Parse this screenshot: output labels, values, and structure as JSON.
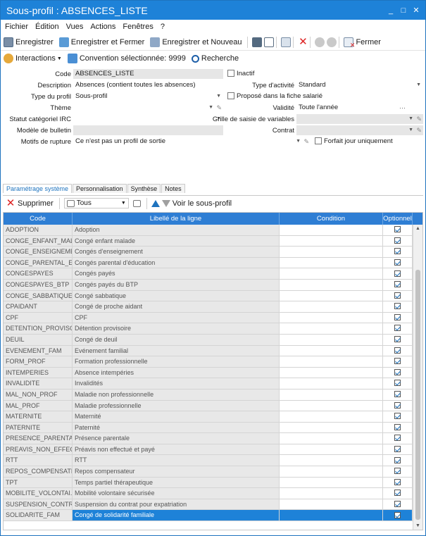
{
  "window": {
    "title": "Sous-profil : ABSENCES_LISTE",
    "controls": [
      "_",
      "□",
      "✕"
    ]
  },
  "menu": [
    "Fichier",
    "Édition",
    "Vues",
    "Actions",
    "Fenêtres",
    "?"
  ],
  "toolbar": {
    "save": "Enregistrer",
    "save_close": "Enregistrer et Fermer",
    "save_new": "Enregistrer et Nouveau",
    "close": "Fermer"
  },
  "toolbar2": {
    "interactions": "Interactions",
    "convention": "Convention sélectionnée: 9999",
    "search": "Recherche"
  },
  "form": {
    "code_label": "Code",
    "code_value": "ABSENCES_LISTE",
    "desc_label": "Description",
    "desc_value": "Absences (contient toutes les absences)",
    "type_label": "Type du profil",
    "type_value": "Sous-profil",
    "theme_label": "Thème",
    "statut_label": "Statut catégoriel IRC",
    "modele_label": "Modèle de bulletin",
    "motifs_label": "Motifs de rupture",
    "motifs_value": "Ce n'est pas un profil de sortie",
    "inactif_label": "Inactif",
    "type_activite_label": "Type d'activité",
    "type_activite_value": "Standard",
    "propose_label": "Proposé dans la fiche salarié",
    "validite_label": "Validité",
    "validite_value": "Toute l'année",
    "grille_label": "Grille de saisie de variables",
    "contrat_label": "Contrat",
    "forfait_label": "Forfait jour uniquement"
  },
  "tabs": [
    "Paramétrage système",
    "Personnalisation",
    "Synthèse",
    "Notes"
  ],
  "gridbar": {
    "delete": "Supprimer",
    "filter": "Tous",
    "view": "Voir le sous-profil"
  },
  "grid": {
    "headers": [
      "Code",
      "Libellé de la ligne",
      "Condition",
      "Optionnel"
    ],
    "rows": [
      [
        "ADOPTION",
        "Adoption"
      ],
      [
        "CONGE_ENFANT_MAL...",
        "Congé enfant malade"
      ],
      [
        "CONGE_ENSEIGNEMENT",
        "Congés d'enseignement"
      ],
      [
        "CONGE_PARENTAL_E...",
        "Congés parental d'éducation"
      ],
      [
        "CONGESPAYES",
        "Congés payés"
      ],
      [
        "CONGESPAYES_BTP",
        "Congés payés du BTP"
      ],
      [
        "CONGE_SABBATIQUE",
        "Congé sabbatique"
      ],
      [
        "CPAIDANT",
        "Congé de proche aidant"
      ],
      [
        "CPF",
        "CPF"
      ],
      [
        "DETENTION_PROVISO...",
        "Détention provisoire"
      ],
      [
        "DEUIL",
        "Congé de deuil"
      ],
      [
        "EVENEMENT_FAM",
        "Evénement familial"
      ],
      [
        "FORM_PROF",
        "Formation professionnelle"
      ],
      [
        "INTEMPERIES",
        "Absence intempéries"
      ],
      [
        "INVALIDITE",
        "Invalidités"
      ],
      [
        "MAL_NON_PROF",
        "Maladie non professionnelle"
      ],
      [
        "MAL_PROF",
        "Maladie professionnelle"
      ],
      [
        "MATERNITE",
        "Maternité"
      ],
      [
        "PATERNITE",
        "Paternité"
      ],
      [
        "PRESENCE_PARENTALE",
        "Présence parentale"
      ],
      [
        "PREAVIS_NON_EFFEC...",
        "Préavis non effectué et payé"
      ],
      [
        "RTT",
        "RTT"
      ],
      [
        "REPOS_COMPENSATE...",
        "Repos compensateur"
      ],
      [
        "TPT",
        "Temps partiel thérapeutique"
      ],
      [
        "MOBILITE_VOLONTAI...",
        "Mobilité volontaire sécurisée"
      ],
      [
        "SUSPENSION_CONTR...",
        "Suspension du contrat pour expatriation"
      ],
      [
        "SOLIDARITE_FAM",
        "Congé de solidarité familiale"
      ]
    ],
    "selected_index": 26
  },
  "colors": {
    "accent": "#1e82d8",
    "header": "#2e7ed4",
    "delete": "#d22222"
  }
}
